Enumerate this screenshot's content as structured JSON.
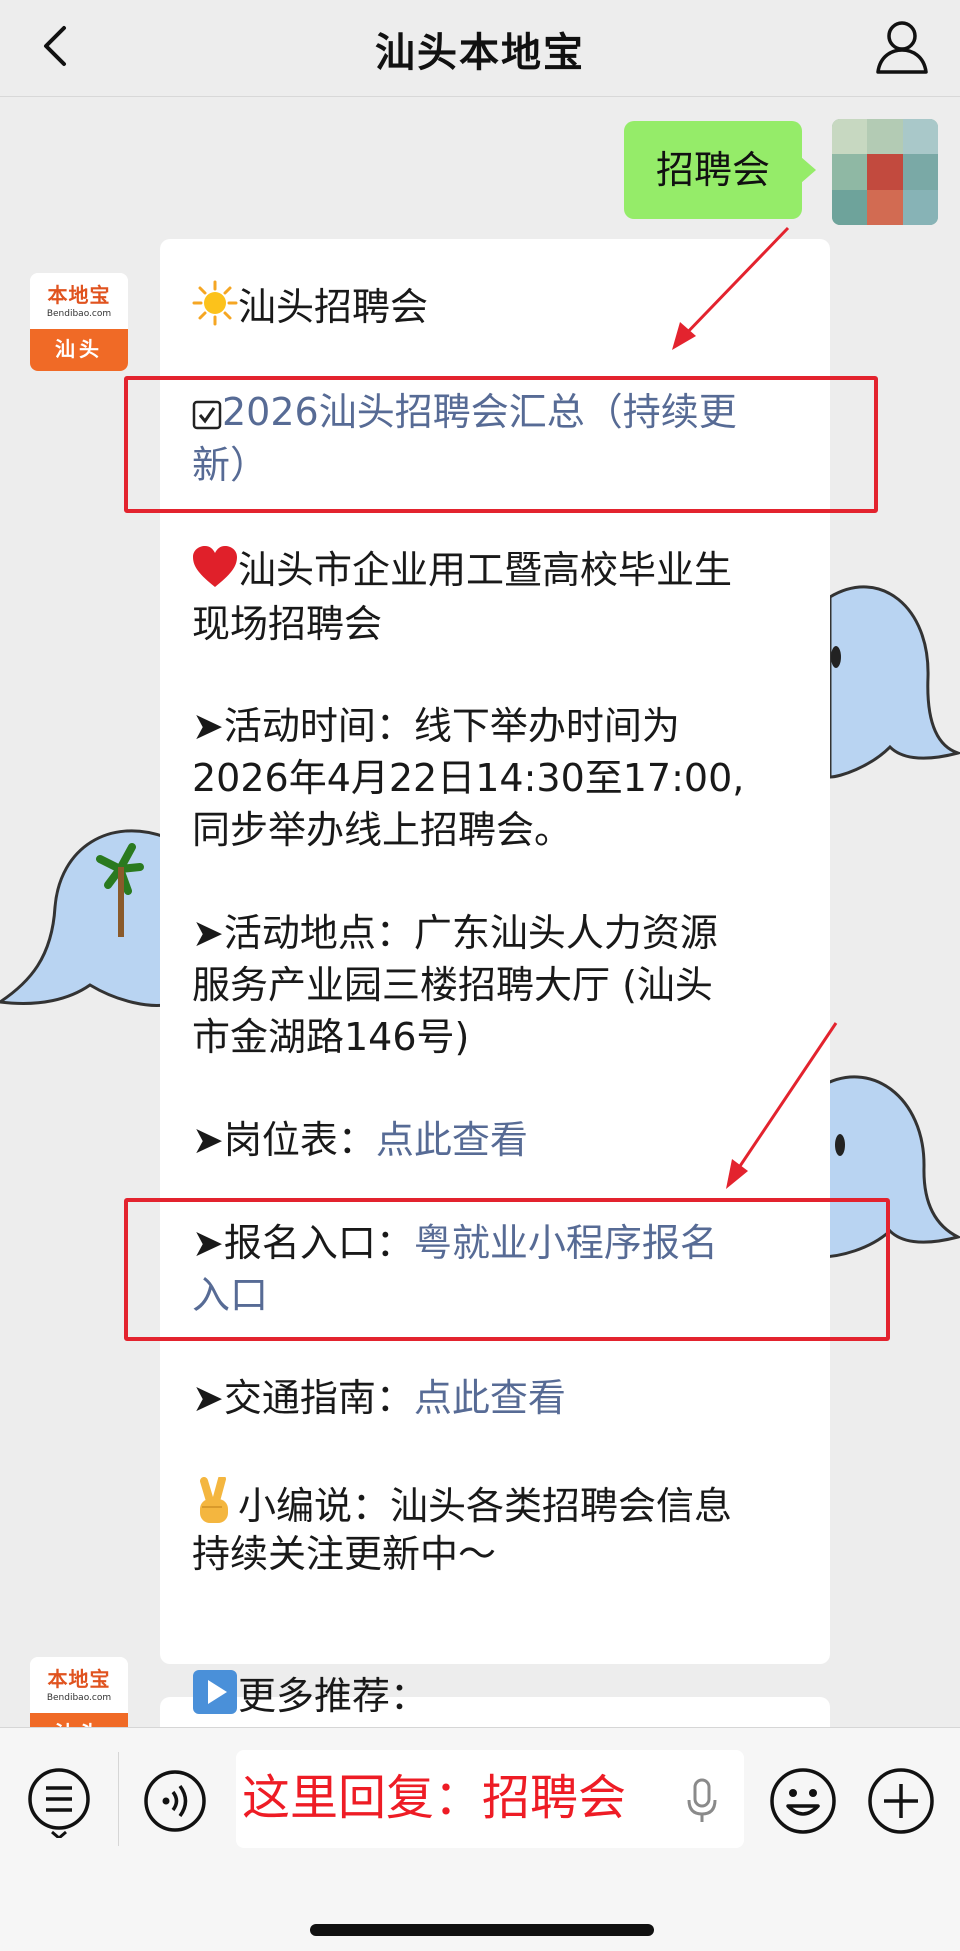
{
  "header": {
    "title": "汕头本地宝"
  },
  "user_message": {
    "text": "招聘会"
  },
  "bot": {
    "avatar_brand": "本地宝",
    "avatar_site": "Bendibao.com",
    "avatar_city": "汕头"
  },
  "message": {
    "intro": "汕头招聘会",
    "summary_link_line1": "2026汕头招聘会汇总（持续更",
    "summary_link_line2": "新）",
    "event_title_line1": "汕头市企业用工暨高校毕业生",
    "event_title_line2": "现场招聘会",
    "time_line1": "➤活动时间：线下举办时间为",
    "time_line2": "2026年4月22日14:30至17:00,",
    "time_line3": "同步举办线上招聘会。",
    "place_line1": "➤活动地点：广东汕头人力资源",
    "place_line2": "服务产业园三楼招聘大厅 (汕头",
    "place_line3": "市金湖路146号)",
    "jobs_label": "➤岗位表：",
    "jobs_link": "点此查看",
    "signup_label": "➤报名入口：",
    "signup_link_line1": "粤就业小程序报名",
    "signup_link_line2": "入口",
    "traffic_label": "➤交通指南：",
    "traffic_link": "点此查看",
    "editor_line1": "小编说：汕头各类招聘会信息",
    "editor_line2": "持续关注更新中～"
  },
  "message2": {
    "more": "更多推荐："
  },
  "input": {
    "reply_hint": "这里回复：招聘会"
  },
  "icons": {
    "back": "chevron-left-icon",
    "profile": "person-icon",
    "sun": "sun-emoji",
    "check": "check-box-icon",
    "heart": "red-heart-emoji",
    "victory": "victory-hand-emoji",
    "play": "play-button-emoji",
    "menu": "list-menu-icon",
    "voice": "voice-icon",
    "mic": "microphone-icon",
    "emoji": "smiley-icon",
    "add": "plus-icon"
  },
  "colors": {
    "link": "#576b95",
    "user_bubble": "#95ec69",
    "highlight_box": "#e3232e",
    "reply_hint": "#ee1c25"
  }
}
